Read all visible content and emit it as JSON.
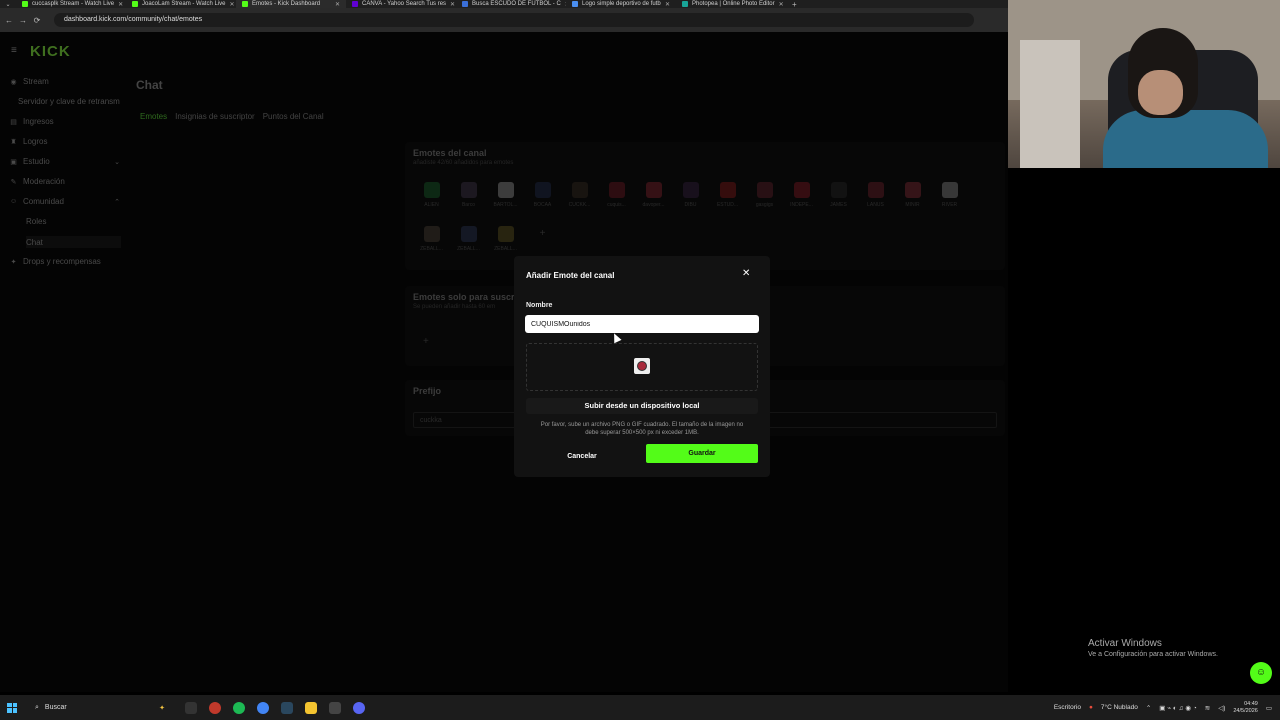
{
  "browser": {
    "tabs": [
      {
        "title": "cuccasplk Stream - Watch Live",
        "color": "#53fc18",
        "active": false
      },
      {
        "title": "JoacoLam Stream - Watch Live",
        "color": "#53fc18",
        "active": false
      },
      {
        "title": "Emotes - Kick Dashboard",
        "color": "#53fc18",
        "active": true
      },
      {
        "title": "CANVA - Yahoo Search Tus res",
        "color": "#6001d2",
        "active": false
      },
      {
        "title": "Busca ESCUDO DE FUTBOL - C",
        "color": "#3a6fd8",
        "active": false
      },
      {
        "title": "Logo simple deportivo de futb",
        "color": "#4a8ef0",
        "active": false
      },
      {
        "title": "Photopea | Online Photo Editor",
        "color": "#18a497",
        "active": false
      }
    ],
    "url": "dashboard.kick.com/community/chat/emotes"
  },
  "sidebar": {
    "logo": "KICK",
    "items": [
      {
        "label": "Stream",
        "icon": "broadcast-icon"
      },
      {
        "label": "Servidor y clave de retransm",
        "icon": ""
      },
      {
        "label": "Ingresos",
        "icon": "money-icon"
      },
      {
        "label": "Logros",
        "icon": "trophy-icon"
      },
      {
        "label": "Estudio",
        "icon": "studio-icon"
      },
      {
        "label": "Moderación",
        "icon": "wrench-icon"
      },
      {
        "label": "Comunidad",
        "icon": "community-icon"
      },
      {
        "label": "Roles",
        "icon": ""
      },
      {
        "label": "Chat",
        "icon": ""
      },
      {
        "label": "Drops y recompensas",
        "icon": "gift-icon"
      }
    ]
  },
  "main": {
    "title": "Chat",
    "tabs": [
      "Emotes",
      "Insignias de suscriptor",
      "Puntos del Canal"
    ],
    "channel_emotes": {
      "title": "Emotes del canal",
      "subtitle": "añadiste 42/60 añadidos para emotes",
      "emotes": [
        "ALIEN",
        "Barco",
        "BARTOL...",
        "BOCAA",
        "CUCKK...",
        "cuquis...",
        "davoper...",
        "DIBU",
        "ESTUD...",
        "gasgigs",
        "INDEPE...",
        "JAMES",
        "LANUS",
        "MINIR",
        "RIVER",
        "ZEBALL...",
        "ZEBALL...",
        "ZEBALL..."
      ],
      "emote_colors": [
        "#1e8a3a",
        "#5c4a6b",
        "#ddd",
        "#2b3c6b",
        "#4a3a2a",
        "#a02030",
        "#c03040",
        "#4a2a5a",
        "#c02020",
        "#8a2a3a",
        "#c02030",
        "#333",
        "#a02a3a",
        "#c03a4a",
        "#c8c8c8",
        "#6a5a4a",
        "#3a4a7a",
        "#8a7a2a"
      ]
    },
    "sub_emotes": {
      "title": "Emotes solo para suscr",
      "subtitle": "Se pueden añadir hasta 60 em"
    },
    "prefix": {
      "title": "Prefijo",
      "value": "cuckka"
    }
  },
  "modal": {
    "title": "Añadir Emote del canal",
    "name_label": "Nombre",
    "name_value": "CUQUISMOunidos",
    "upload_label": "Subir desde un dispositivo local",
    "hint": "Por favor, sube un archivo PNG o GIF cuadrado. El tamaño de la imagen no debe superar 500×500 px ni exceder 1MB.",
    "cancel_label": "Cancelar",
    "save_label": "Guardar"
  },
  "watermark": {
    "line1": "Activar Windows",
    "line2": "Ve a Configuración para activar Windows."
  },
  "taskbar": {
    "search_placeholder": "Buscar",
    "tray_label": "Escritorio",
    "weather": "7°C  Nublado",
    "time": "04:49",
    "date": "24/5/2026"
  }
}
